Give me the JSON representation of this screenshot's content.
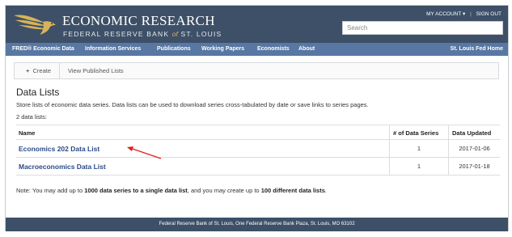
{
  "header": {
    "brand_title": "ECONOMIC RESEARCH",
    "brand_sub_prefix": "FEDERAL RESERVE BANK",
    "brand_sub_of": "of",
    "brand_sub_suffix": "ST. LOUIS",
    "account_label": "MY ACCOUNT ▾",
    "signout_label": "SIGN OUT",
    "search_placeholder": "Search"
  },
  "nav": {
    "items": [
      "FRED® Economic Data",
      "Information Services",
      "Publications",
      "Working Papers",
      "Economists",
      "About"
    ],
    "right_item": "St. Louis Fed Home"
  },
  "toolbar": {
    "create_label": "Create",
    "published_label": "View Published Lists"
  },
  "main": {
    "title": "Data Lists",
    "description": "Store lists of economic data series. Data lists can be used to download series cross-tabulated by date or save links to series pages.",
    "count_text": "2 data lists:"
  },
  "table": {
    "headers": [
      "Name",
      "# of Data Series",
      "Data Updated"
    ],
    "rows": [
      {
        "name": "Economics 202 Data List",
        "series": "1",
        "updated": "2017-01-06"
      },
      {
        "name": "Macroeconomics Data List",
        "series": "1",
        "updated": "2017-01-18"
      }
    ]
  },
  "note": {
    "p1": "Note: You may add up to ",
    "b1": "1000 data series to a single data list",
    "p2": ", and you may create up to ",
    "b2": "100 different data lists",
    "p3": "."
  },
  "footer": {
    "text": "Federal Reserve Bank of St. Louis, One Federal Reserve Bank Plaza, St. Louis, MO 63102"
  },
  "colors": {
    "header_bg": "#3d5068",
    "nav_bg": "#5877a3",
    "link": "#2c4a86",
    "annotation_arrow": "#e0211d",
    "logo_gold": "#d8b25a"
  },
  "icons": [
    "eagle-logo-icon",
    "plus-icon",
    "dropdown-caret-icon",
    "annotation-arrow"
  ]
}
